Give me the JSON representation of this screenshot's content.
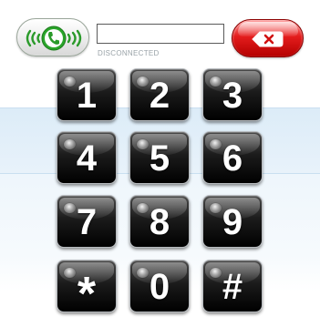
{
  "header": {
    "call_button": {
      "icon": "phone-handset-icon",
      "color": "#2a9a2a"
    },
    "number_display": {
      "value": "",
      "placeholder": ""
    },
    "status": "DISCONNECTED",
    "clear_button": {
      "icon": "backspace-icon",
      "color": "#e41d1d"
    }
  },
  "keypad": {
    "keys": [
      "1",
      "2",
      "3",
      "4",
      "5",
      "6",
      "7",
      "8",
      "9",
      "*",
      "0",
      "#"
    ]
  }
}
